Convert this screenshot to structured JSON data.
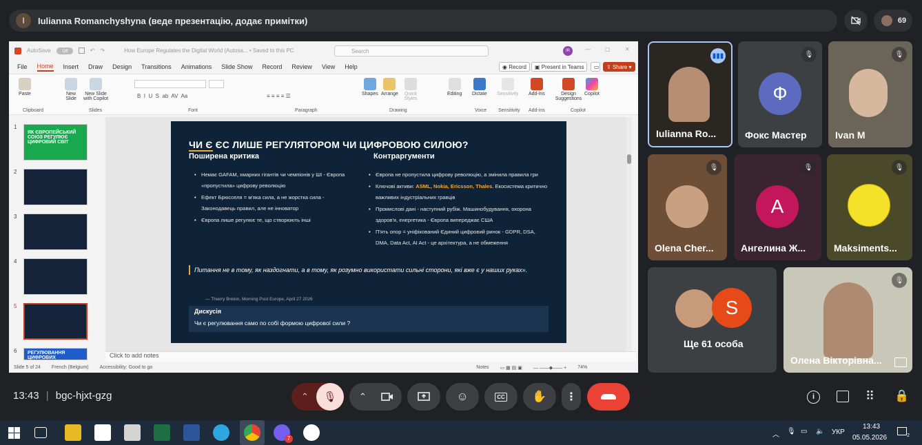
{
  "meeting": {
    "presenter_initial": "I",
    "presenter_banner": "Iulianna Romanchyshyna (веде презентацію, додає примітки)",
    "participant_count": "69",
    "time": "13:43",
    "meeting_code": "bgc-hjxt-gzg"
  },
  "ppt": {
    "autosave_label": "AutoSave",
    "toggle_state": "Off",
    "doc_title": "How Europe Regulates the Digital World (Autosa... • Saved to this PC",
    "search_placeholder": "Search",
    "user_initials": "IR",
    "menu": [
      "File",
      "Home",
      "Insert",
      "Draw",
      "Design",
      "Transitions",
      "Animations",
      "Slide Show",
      "Record",
      "Review",
      "View",
      "Help"
    ],
    "record_btn": "Record",
    "present_btn": "Present in Teams",
    "share_btn": "Share",
    "ribbon": {
      "paste": "Paste",
      "new_slide": "New Slide",
      "new_slide_copilot": "New Slide with Copilot",
      "shapes": "Shapes",
      "arrange": "Arrange",
      "quick_styles": "Quick Styles",
      "editing": "Editing",
      "dictate": "Dictate",
      "sensitivity": "Sensitivity",
      "addins": "Add-ins",
      "design_suggestions": "Design Suggestions",
      "copilot": "Copilot",
      "groups": [
        "Clipboard",
        "Slides",
        "Font",
        "Paragraph",
        "Drawing",
        "Voice",
        "Sensitivity",
        "Add-ins",
        "Copilot"
      ]
    },
    "thumbs": [
      {
        "num": "1",
        "text": "ЯК ЄВРОПЕЙСЬКИЙ СОЮЗ РЕГУЛЮЄ ЦИФРОВИЙ СВІТ"
      },
      {
        "num": "2",
        "text": ""
      },
      {
        "num": "3",
        "text": ""
      },
      {
        "num": "4",
        "text": ""
      },
      {
        "num": "5",
        "text": ""
      },
      {
        "num": "6",
        "text": "РЕГУЛЮВАННЯ ЦИФРОВИХ"
      }
    ],
    "slide": {
      "title_a": "ЧИ Є",
      "title_b": " ЄС ЛИШЕ РЕГУЛЯТОРОМ  ЧИ ЦИФРОВОЮ СИЛОЮ?",
      "left_head": "Поширена критика",
      "right_head": "Контраргументи",
      "left_bullets": [
        "Немає GAFAM, хмарних гігантів чи чемпіонів у ШІ - Європа «пропустила» цифрову революцію",
        "Ефект Брюсселя = м'яка сила, а не жорстка сила - Законодавець правил, але не інноватор",
        "Європа лише регулює те, що створюють інші"
      ],
      "right_b1": "Європа не пропустила цифрову революцію, а змінила правила гри",
      "right_b2_pre": "Ключові активи: ",
      "right_b2_hl": "ASML, Nokia, Ericsson, Thales.",
      "right_b2_post": " Екосистема критично важливих індустріальних гравців",
      "right_b3": "Промислові дані -  наступний рубіж. Машинобудування, охорона здоров'я, енергетика -  Європа випереджає США",
      "right_b4": "П'ять опор = уніфікований Єдиний цифровий ринок - GDPR, DSA, DMA, Data Act, AI Act -  це архітектура, а не обмеження",
      "quote": "Питання не в тому, як наздогнати, а в тому, як розумно використати сильні сторони, які вже є у наших руках».",
      "quote_source": "— Thierry Breton, Morning Post Europe, April 27 2026",
      "discussion_head": "Дискусія",
      "discussion_q": "Чи є регулювання само по собі формою цифрової сили ?"
    },
    "notes_placeholder": "Click to add notes",
    "status": {
      "slide": "Slide 5 of 24",
      "lang": "French (Belgium)",
      "accessibility": "Accessibility: Good to go",
      "notes": "Notes",
      "zoom": "74%"
    }
  },
  "participants": [
    {
      "name": "Iulianna Ro...",
      "type": "video"
    },
    {
      "name": "Фокс Мастер",
      "type": "letter",
      "letter": "Ф",
      "color": "#5c6bc0"
    },
    {
      "name": "Ivan M",
      "type": "video"
    },
    {
      "name": "Olena Cher...",
      "type": "avatar"
    },
    {
      "name": "Ангелина Ж...",
      "type": "letter",
      "letter": "А",
      "color": "#c2185b"
    },
    {
      "name": "Maksiments...",
      "type": "avatar"
    },
    {
      "name": "Ще 61 особа",
      "type": "group",
      "letter": "S",
      "color": "#e64a19"
    },
    {
      "name": "Олена Вікторівна...",
      "type": "video"
    }
  ],
  "taskbar": {
    "lang": "УКР",
    "time": "13:43",
    "date": "05.05.2026",
    "notif_count": "2",
    "viber_badge": "7"
  },
  "colors": {
    "accent_red": "#ea4335",
    "slide_bg": "#0e2337",
    "slide_accent": "#f4a83a",
    "ppt_accent": "#c43e1c"
  }
}
